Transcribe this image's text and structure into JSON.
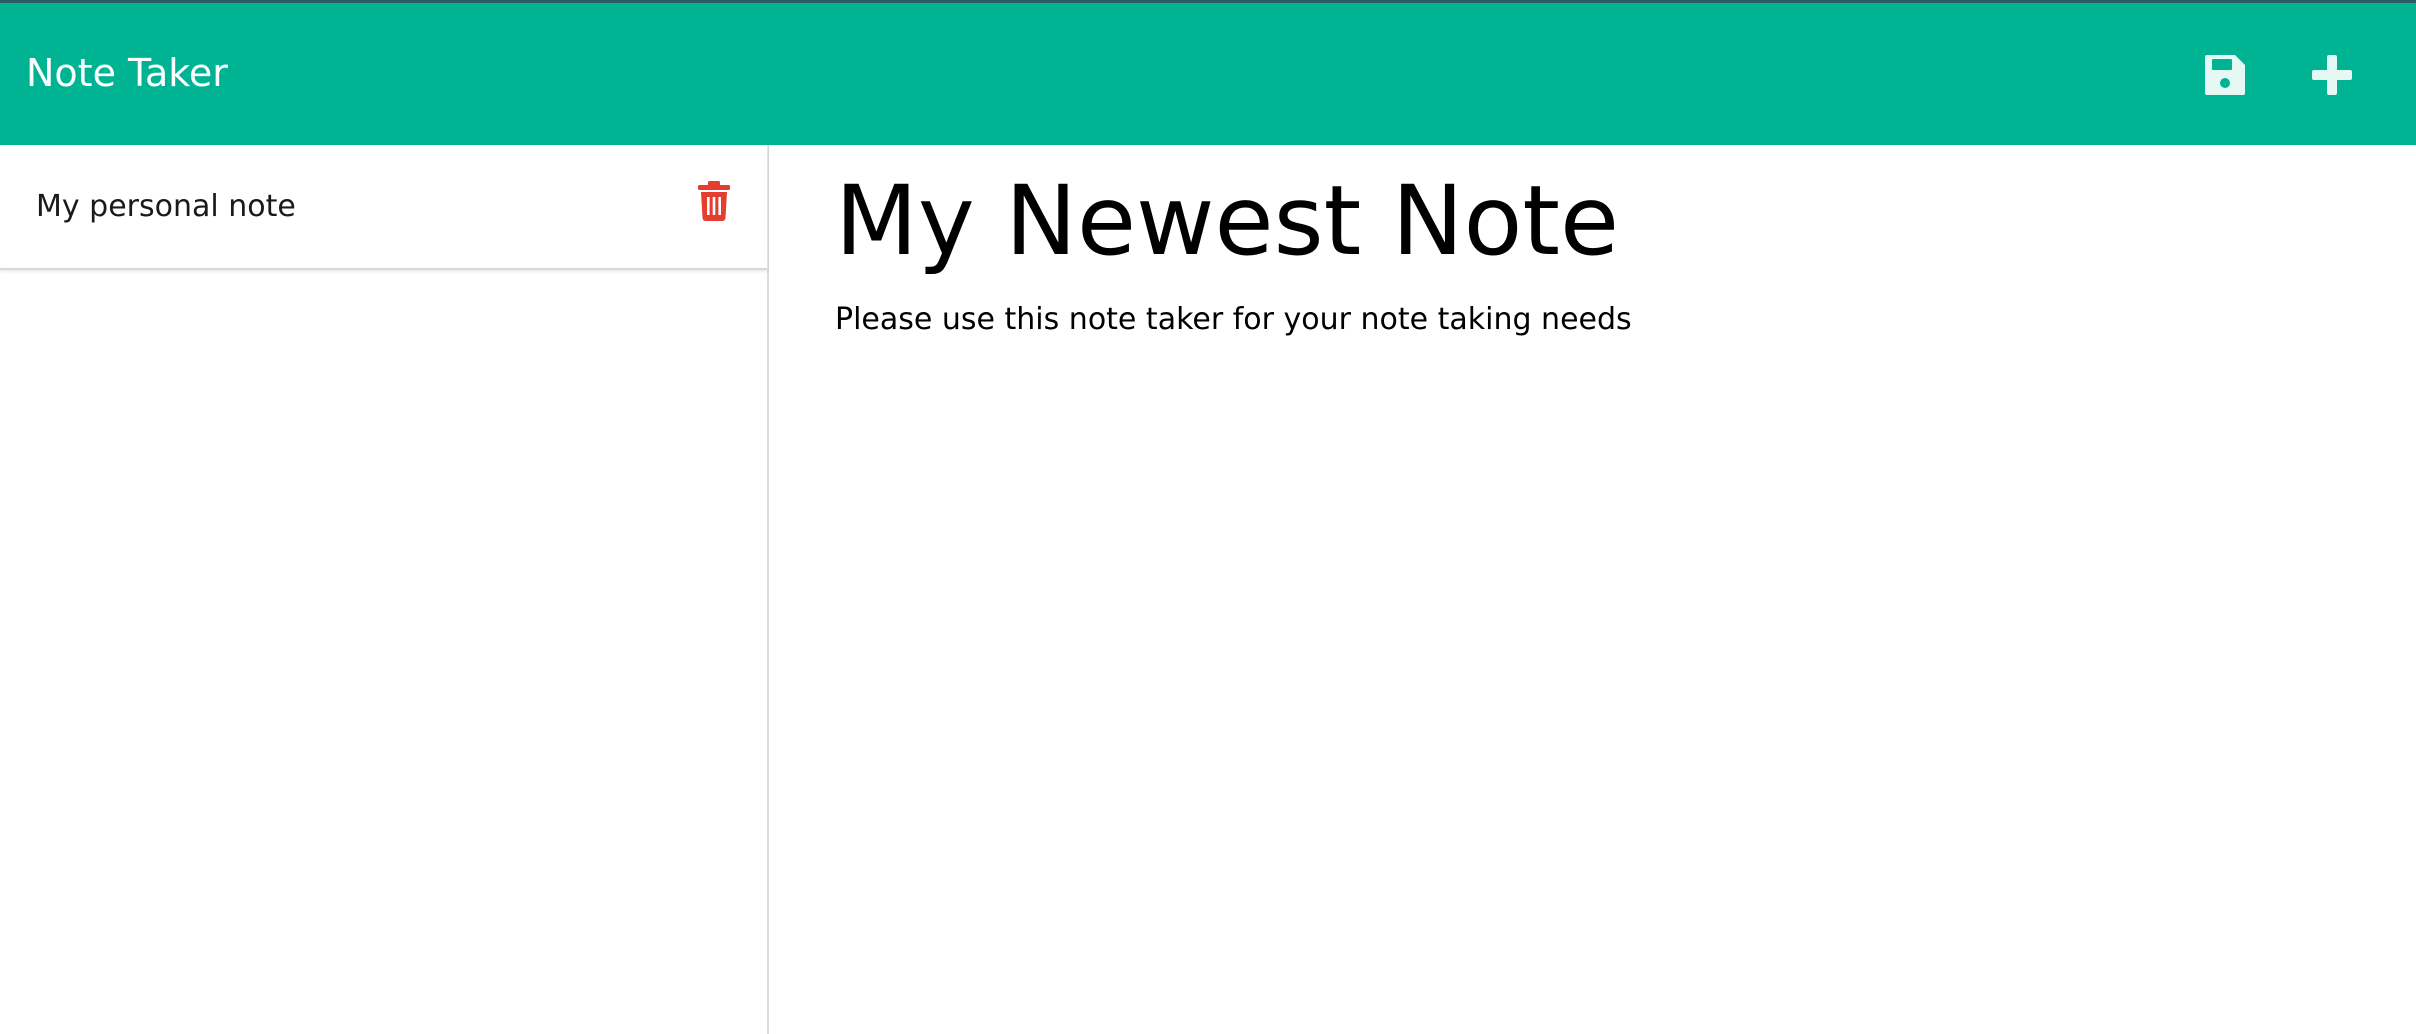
{
  "navbar": {
    "brand": "Note Taker",
    "save_icon": "floppy-disk-icon",
    "new_icon": "plus-icon",
    "background": "#00b493"
  },
  "sidebar": {
    "items": [
      {
        "title": "My personal note",
        "delete_icon": "trash-icon",
        "delete_color": "#e53e30"
      }
    ]
  },
  "main": {
    "note_title": "My Newest Note",
    "note_text": "Please use this note taker for your note taking needs"
  }
}
